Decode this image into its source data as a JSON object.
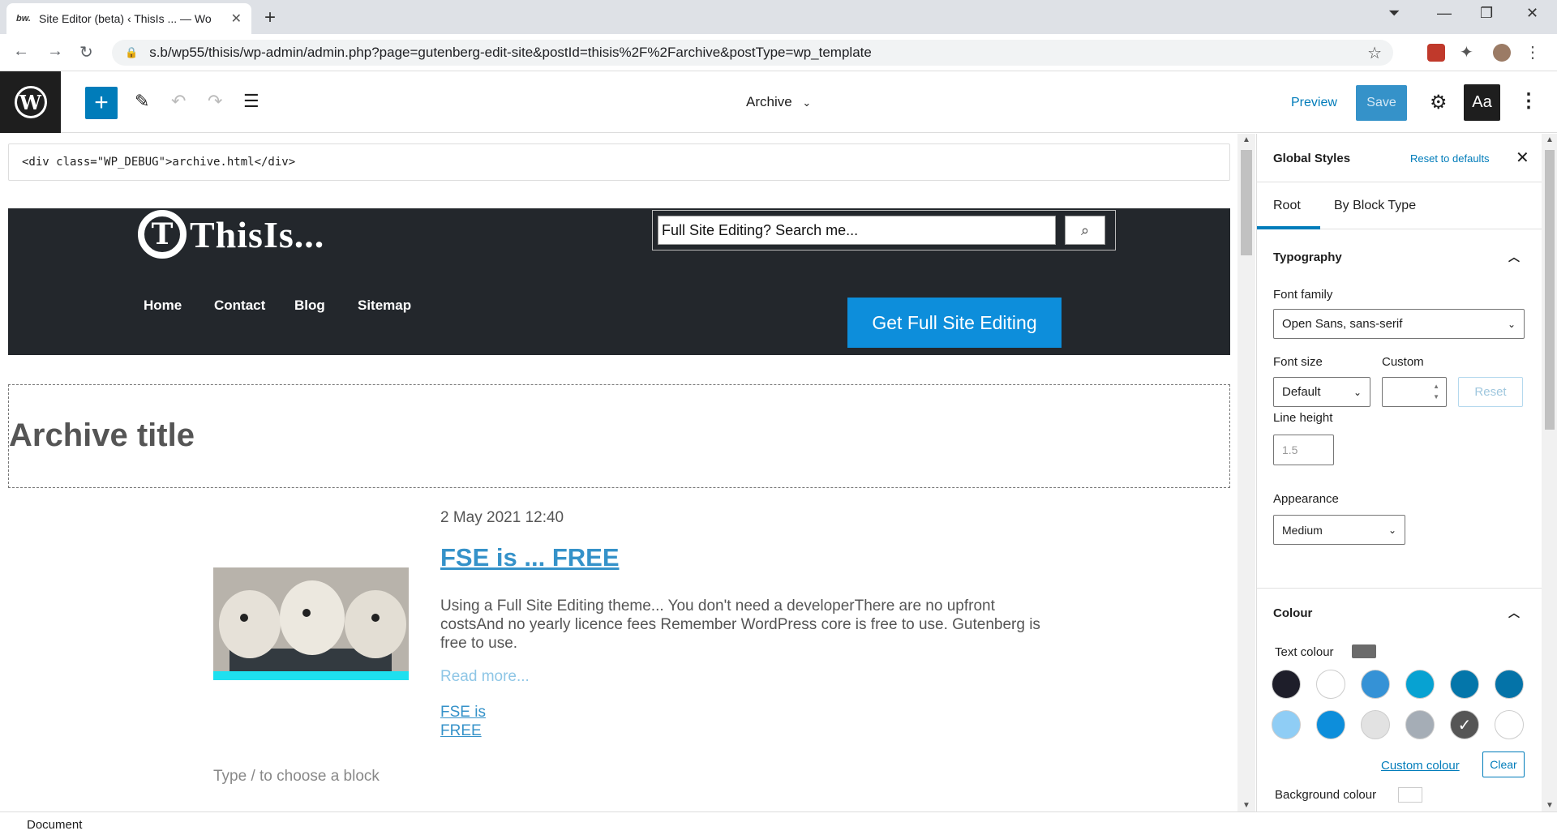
{
  "browser": {
    "tab_title": "Site Editor (beta) ‹ ThisIs ... — Wo",
    "tab_favicon": "bw.",
    "url": "s.b/wp55/thisis/wp-admin/admin.php?page=gutenberg-edit-site&postId=thisis%2F%2Farchive&postType=wp_template"
  },
  "editor": {
    "document_title": "Archive",
    "preview_label": "Preview",
    "save_label": "Save",
    "styles_label": "Aa",
    "accent_color": "#007cba"
  },
  "canvas": {
    "debug_text": "<div class=\"WP_DEBUG\">archive.html</div>",
    "site_name": "ThisIs...",
    "logo_letter": "T",
    "search_placeholder": "Full Site Editing? Search me...",
    "nav": [
      "Home",
      "Contact",
      "Blog",
      "Sitemap"
    ],
    "cta_label": "Get Full Site Editing",
    "archive_title": "Archive title",
    "post": {
      "date": "2 May 2021 12:40",
      "title": "FSE is ... FREE",
      "excerpt": "Using a Full Site Editing theme... You don't need a developerThere are no upfront costsAnd no yearly licence fees Remember WordPress core is free to use. Gutenberg is free to use.",
      "read_more": "Read more...",
      "link_text": "FSE is FREE"
    },
    "appender_placeholder": "Type / to choose a block"
  },
  "sidebar": {
    "title": "Global Styles",
    "reset_defaults": "Reset to defaults",
    "tabs": [
      "Root",
      "By Block Type"
    ],
    "typography": {
      "heading": "Typography",
      "font_family_label": "Font family",
      "font_family_value": "Open Sans, sans-serif",
      "font_size_label": "Font size",
      "font_size_value": "Default",
      "custom_label": "Custom",
      "reset_label": "Reset",
      "line_height_label": "Line height",
      "line_height_placeholder": "1.5",
      "appearance_label": "Appearance",
      "appearance_value": "Medium"
    },
    "colour": {
      "heading": "Colour",
      "text_colour_label": "Text colour",
      "text_colour": "#6b6b6b",
      "palette": [
        "#1e1e2a",
        "#ffffff",
        "#3592d6",
        "#07a2d2",
        "#0476aa",
        "#0473a8",
        "#8fcdf5",
        "#0d8edb",
        "#e2e2e2",
        "#a5adb6",
        "#555555",
        "#ffffff"
      ],
      "selected_index": 10,
      "custom_colour_label": "Custom colour",
      "clear_label": "Clear",
      "background_colour_label": "Background colour"
    }
  },
  "footer": {
    "breadcrumb": "Document"
  }
}
